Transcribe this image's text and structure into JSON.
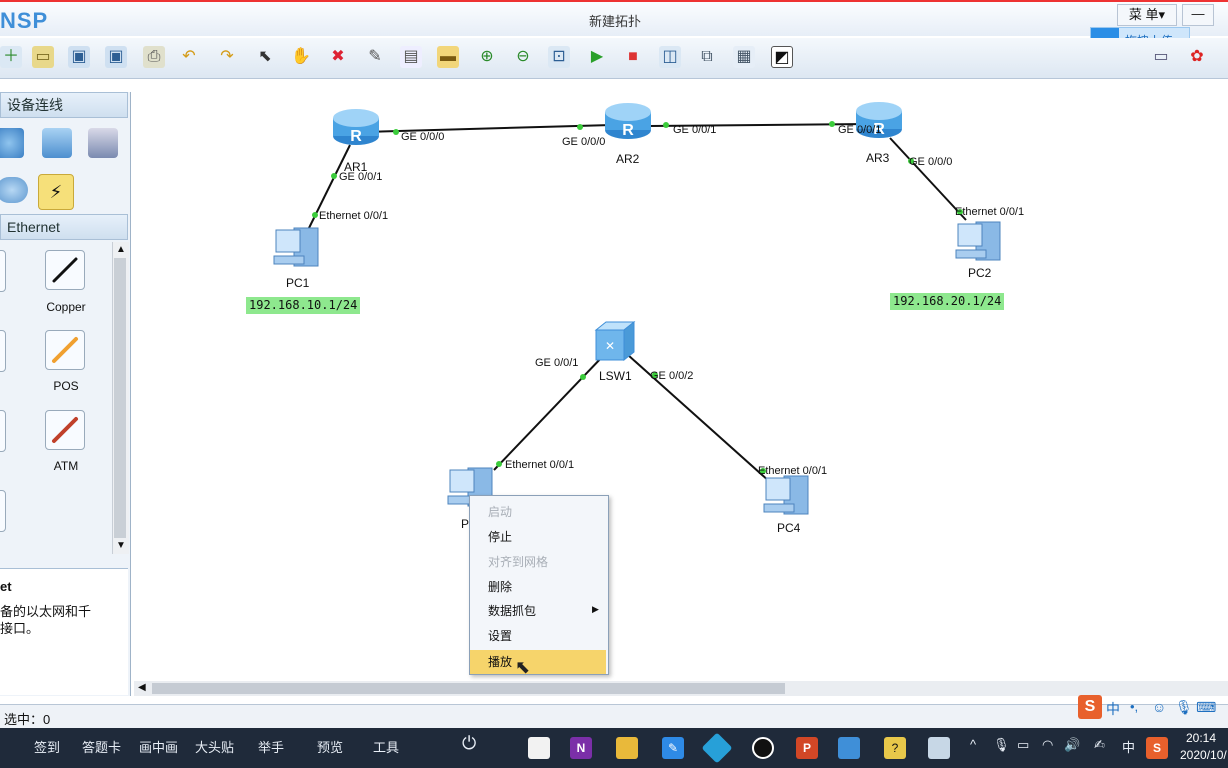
{
  "app": {
    "logo": "NSP",
    "title": "新建拓扑",
    "menu_label": "菜 单▾",
    "minimize_label": "—",
    "upload_label": "拖拽上传"
  },
  "left_panel": {
    "devices_header": "设备连线",
    "cable_category": "Ethernet",
    "cables": [
      {
        "label": "Copper",
        "color": "#111111"
      },
      {
        "label": "POS",
        "color": "#f0a030"
      },
      {
        "label": "ATM",
        "color": "#c0402a"
      }
    ],
    "description_title": "et",
    "description_text_1": "备的以太网和千",
    "description_text_2": "接口。"
  },
  "topology": {
    "devices": [
      {
        "name": "AR1"
      },
      {
        "name": "AR2"
      },
      {
        "name": "AR3"
      },
      {
        "name": "PC1"
      },
      {
        "name": "PC2"
      },
      {
        "name": "LSW1"
      },
      {
        "name": "P"
      },
      {
        "name": "PC4"
      }
    ],
    "ports": {
      "ar1_ge000": "GE 0/0/0",
      "ar1_ge001": "GE 0/0/1",
      "ar2_ge000": "GE 0/0/0",
      "ar2_ge001": "GE 0/0/1",
      "ar3_ge001": "GE 0/0/1",
      "ar3_ge000": "GE 0/0/0",
      "pc1_eth": "Ethernet 0/0/1",
      "pc2_eth": "Ethernet 0/0/1",
      "lsw1_ge001": "GE 0/0/1",
      "lsw1_ge002": "GE 0/0/2",
      "pc3_eth": "Ethernet 0/0/1",
      "pc4_eth": "Ethernet 0/0/1"
    },
    "ip_labels": {
      "pc1": "192.168.10.1/24",
      "pc2": "192.168.20.1/24"
    },
    "link_color": "#111111",
    "port_dot_color": "#3bcc3b",
    "ip_label_color": "#8ee88e"
  },
  "context_menu": {
    "items": [
      {
        "label": "启动",
        "enabled": false
      },
      {
        "label": "停止",
        "enabled": true
      },
      {
        "label": "对齐到网格",
        "enabled": false
      },
      {
        "label": "删除",
        "enabled": true
      },
      {
        "label": "数据抓包",
        "enabled": true,
        "submenu": true
      },
      {
        "label": "设置",
        "enabled": true
      },
      {
        "label": "播放",
        "enabled": true,
        "highlighted": true
      }
    ]
  },
  "status": {
    "selected_text": "选中：0"
  },
  "taskbar": {
    "items": [
      "签到",
      "答题卡",
      "画中画",
      "大头贴",
      "举手",
      "预览",
      "工具"
    ],
    "ime_label": "中",
    "tray_lang": "中",
    "clock_time": "20:14",
    "clock_date": "2020/10/"
  }
}
